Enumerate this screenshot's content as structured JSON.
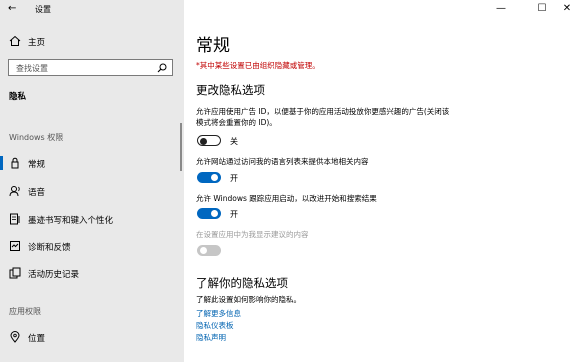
{
  "window": {
    "title": "设置",
    "minimize": "—",
    "maximize": "☐",
    "close": "✕"
  },
  "sidebar": {
    "home": "主页",
    "search_placeholder": "查找设置",
    "current_section": "隐私",
    "windows_permissions_header": "Windows 权限",
    "windows_items": [
      {
        "label": "常规",
        "icon": "lock-icon"
      },
      {
        "label": "语音",
        "icon": "speech-icon"
      },
      {
        "label": "墨迹书写和键入个性化",
        "icon": "pen-icon"
      },
      {
        "label": "诊断和反馈",
        "icon": "diagnostics-icon"
      },
      {
        "label": "活动历史记录",
        "icon": "history-icon"
      }
    ],
    "app_permissions_header": "应用权限",
    "app_items": [
      {
        "label": "位置",
        "icon": "location-icon"
      }
    ]
  },
  "main": {
    "title": "常规",
    "managed_note": "*其中某些设置已由组织隐藏或管理。",
    "change_options_header": "更改隐私选项",
    "settings": [
      {
        "desc": "允许应用使用广告 ID，以便基于你的应用活动投放你更感兴趣的广告(关闭该模式将会重置你的 ID)。",
        "state": "关",
        "on": false,
        "disabled": false
      },
      {
        "desc": "允许网站通过访问我的语言列表来提供本地相关内容",
        "state": "开",
        "on": true,
        "disabled": false
      },
      {
        "desc": "允许 Windows 跟踪应用启动，以改进开始和搜索结果",
        "state": "开",
        "on": true,
        "disabled": false
      },
      {
        "desc": "在设置应用中为我显示建议的内容",
        "state": "",
        "on": false,
        "disabled": true
      }
    ],
    "learn_header": "了解你的隐私选项",
    "learn_desc": "了解此设置如何影响你的隐私。",
    "links": [
      "了解更多信息",
      "隐私仪表板",
      "隐私声明"
    ]
  }
}
